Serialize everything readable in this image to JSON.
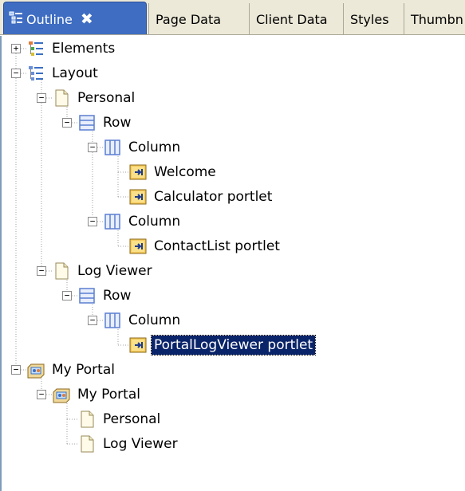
{
  "tabs": [
    {
      "label": "Outline",
      "active": true,
      "icon": "outline-icon"
    },
    {
      "label": "Page Data",
      "active": false
    },
    {
      "label": "Client Data",
      "active": false
    },
    {
      "label": "Styles",
      "active": false
    },
    {
      "label": "Thumbn",
      "active": false
    }
  ],
  "tab_close_glyph": "✖",
  "tree": [
    {
      "label": "Elements",
      "level": 0,
      "icon": "elements-icon",
      "expander": "+"
    },
    {
      "label": "Layout",
      "level": 0,
      "icon": "layout-icon",
      "expander": "−"
    },
    {
      "label": "Personal",
      "level": 1,
      "icon": "page-icon",
      "expander": "−"
    },
    {
      "label": "Row",
      "level": 2,
      "icon": "row-icon",
      "expander": "−"
    },
    {
      "label": "Column",
      "level": 3,
      "icon": "column-icon",
      "expander": "−"
    },
    {
      "label": "Welcome",
      "level": 4,
      "icon": "portlet-icon"
    },
    {
      "label": "Calculator portlet",
      "level": 4,
      "icon": "portlet-icon"
    },
    {
      "label": "Column",
      "level": 3,
      "icon": "column-icon",
      "expander": "−"
    },
    {
      "label": "ContactList portlet",
      "level": 4,
      "icon": "portlet-icon"
    },
    {
      "label": "Log Viewer",
      "level": 1,
      "icon": "page-icon",
      "expander": "−"
    },
    {
      "label": "Row",
      "level": 2,
      "icon": "row-icon",
      "expander": "−"
    },
    {
      "label": "Column",
      "level": 3,
      "icon": "column-icon",
      "expander": "−"
    },
    {
      "label": "PortalLogViewer portlet",
      "level": 4,
      "icon": "portlet-icon",
      "selected": true
    },
    {
      "label": "My Portal",
      "level": 0,
      "icon": "portal-icon",
      "expander": "−"
    },
    {
      "label": "My Portal",
      "level": 1,
      "icon": "portal-icon",
      "expander": "−"
    },
    {
      "label": "Personal",
      "level": 2,
      "icon": "page-icon"
    },
    {
      "label": "Log Viewer",
      "level": 2,
      "icon": "page-icon"
    }
  ],
  "colors": {
    "active_tab": "#3e6dc2",
    "selection": "#0a246a",
    "tab_bar": "#ece9d8",
    "icon_blue": "#5b7fd1",
    "portlet_orange": "#e8b84a"
  }
}
